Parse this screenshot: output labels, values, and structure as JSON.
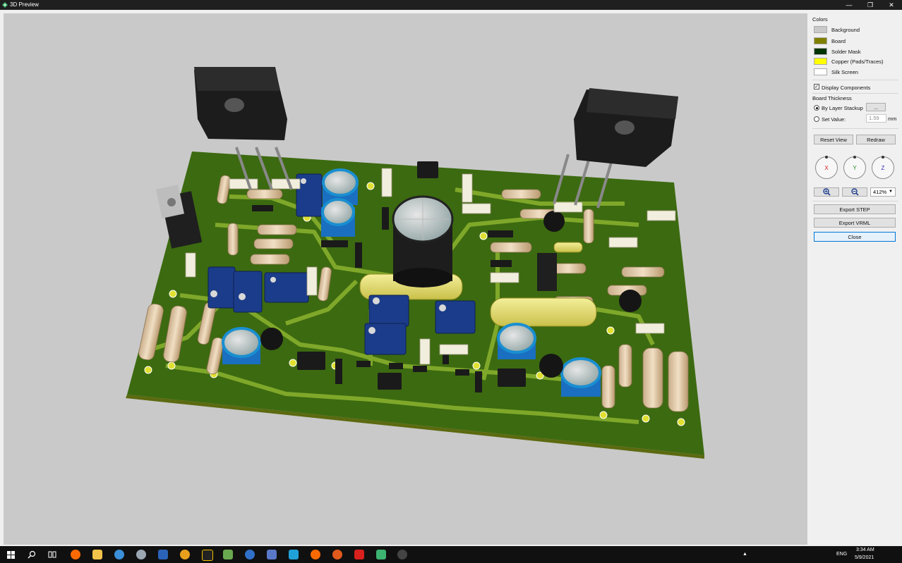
{
  "window": {
    "title": "3D Preview",
    "controls": [
      "minimize",
      "maximize",
      "close"
    ]
  },
  "panel": {
    "colors_heading": "Colors",
    "colors": [
      {
        "label": "Background",
        "color": "#c9c9c9"
      },
      {
        "label": "Board",
        "color": "#808000"
      },
      {
        "label": "Solder Mask",
        "color": "#003300"
      },
      {
        "label": "Copper (Pads/Traces)",
        "color": "#ffff00"
      },
      {
        "label": "Silk Screen",
        "color": "#ffffff"
      }
    ],
    "display_components_label": "Display Components",
    "display_components_checked": true,
    "board_thickness_label": "Board Thickness",
    "by_layer_stackup_label": "By Layer Stackup",
    "by_layer_stackup_button": "...",
    "set_value_label": "Set Value:",
    "set_value": "1.59",
    "unit": "mm",
    "reset_view_label": "Reset View",
    "redraw_label": "Redraw",
    "axes": [
      {
        "label": "X",
        "color": "#d42020"
      },
      {
        "label": "Y",
        "color": "#1f8a1f"
      },
      {
        "label": "Z",
        "color": "#3030c0"
      }
    ],
    "zoom_level": "412%",
    "export_step_label": "Export STEP",
    "export_vrml_label": "Export VRML",
    "close_label": "Close"
  },
  "taskbar": {
    "language": "ENG",
    "time": "3:34 AM",
    "date": "5/9/2021"
  }
}
